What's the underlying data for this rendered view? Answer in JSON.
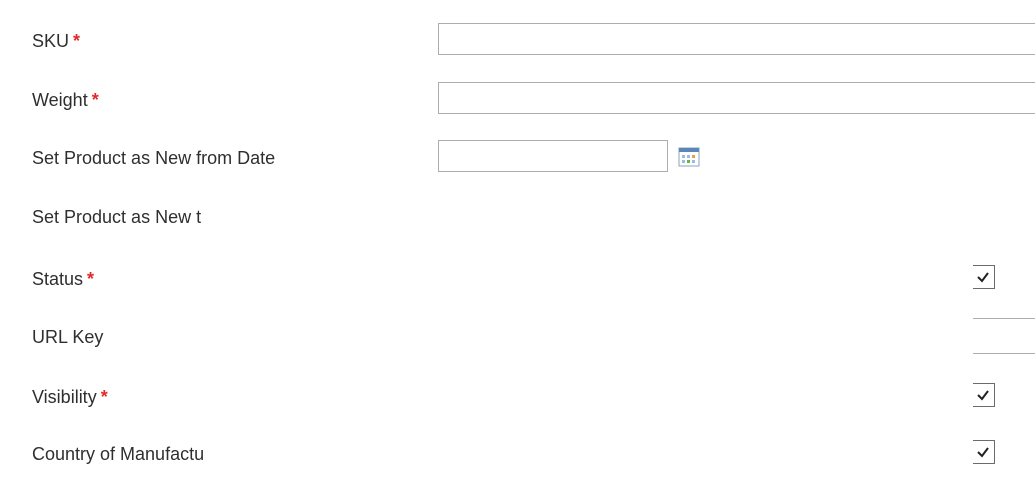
{
  "form": {
    "fields": [
      {
        "label": "SKU",
        "required_mark": "*",
        "value": ""
      },
      {
        "label": "Weight",
        "required_mark": "*",
        "value": ""
      },
      {
        "label": "Set Product as New from Date",
        "value": ""
      },
      {
        "label": "Set Product as New t"
      },
      {
        "label": "Status",
        "required_mark": "*"
      },
      {
        "label": "URL Key"
      },
      {
        "label": "Visibility",
        "required_mark": "*"
      },
      {
        "label": "Country of Manufactu"
      }
    ]
  },
  "colors": {
    "required": "#e02b27",
    "label_text": "#2f2f2f",
    "input_border": "#adadad"
  },
  "icons": {
    "date_picker": "calendar-icon",
    "dropdown": "checkmark-icon"
  }
}
